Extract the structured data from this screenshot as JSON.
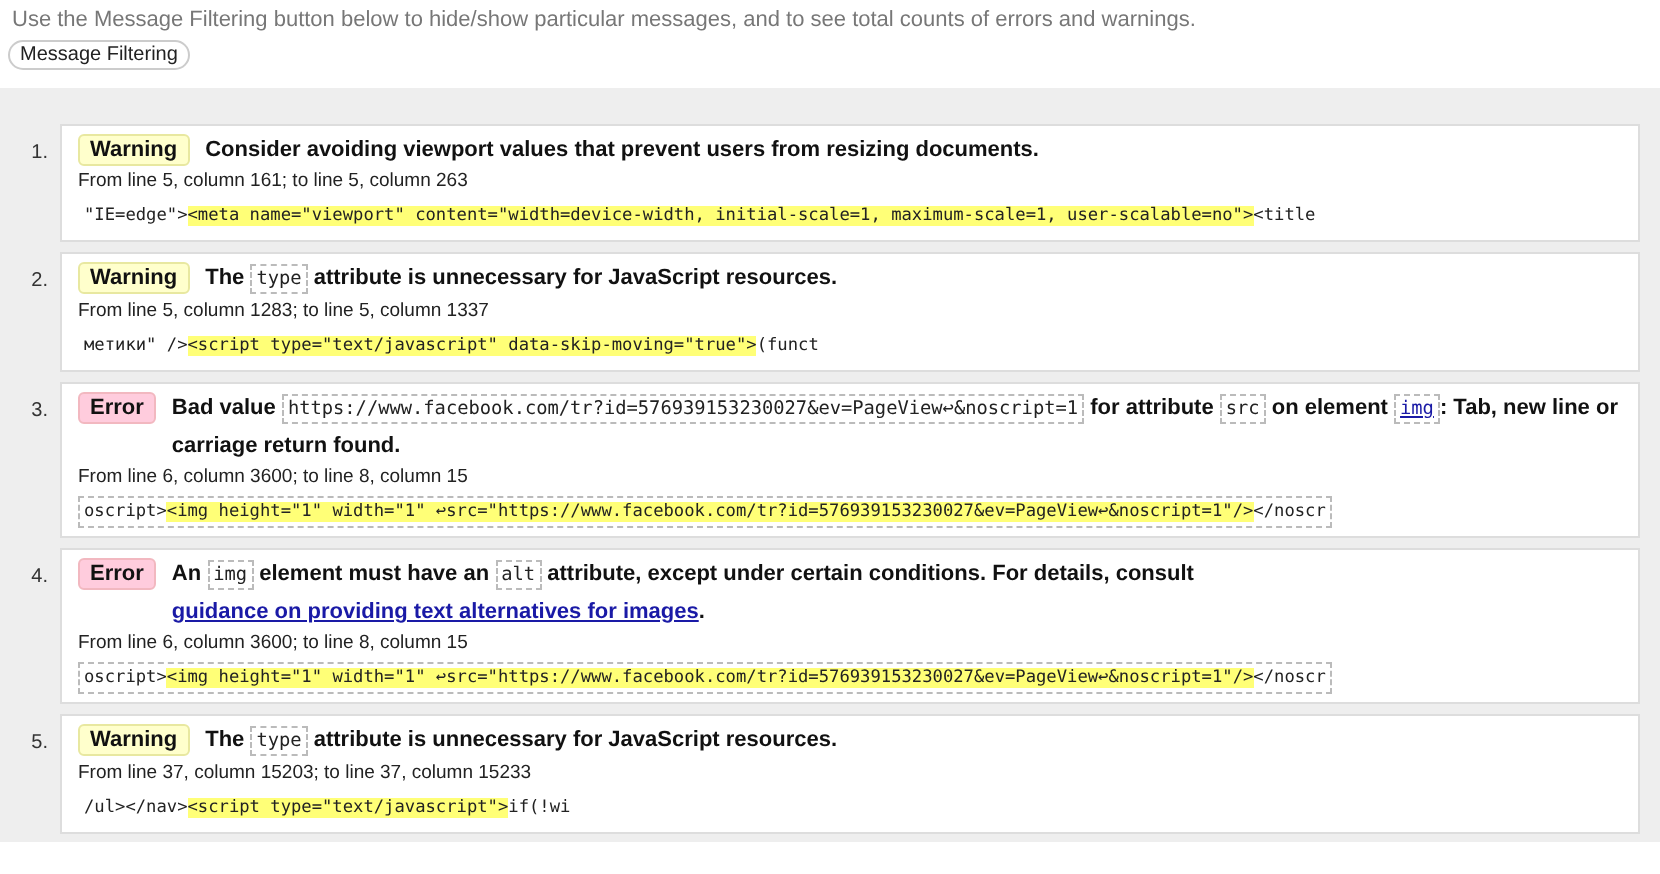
{
  "intro": "Use the Message Filtering button below to hide/show particular messages, and to see total counts of errors and warnings.",
  "filter_button": "Message Filtering",
  "messages": [
    {
      "number": "1.",
      "kind": "warning",
      "severity": "Warning",
      "parts": [
        {
          "kind": "text",
          "text": "Consider avoiding viewport values that prevent users from resizing documents."
        }
      ],
      "location": "From line 5, column 161; to line 5, column 263",
      "extract": {
        "before": "\"IE=edge\">",
        "highlight": "<meta name=\"viewport\" content=\"width=device-width, initial-scale=1, maximum-scale=1, user-scalable=no\">",
        "after": "<title"
      }
    },
    {
      "number": "2.",
      "kind": "warning",
      "severity": "Warning",
      "parts": [
        {
          "kind": "text",
          "text": "The "
        },
        {
          "kind": "code",
          "text": "type"
        },
        {
          "kind": "text",
          "text": " attribute is unnecessary for JavaScript resources."
        }
      ],
      "location": "From line 5, column 1283; to line 5, column 1337",
      "extract": {
        "before": "метики\" />",
        "highlight": "<script type=\"text/javascript\" data-skip-moving=\"true\">",
        "after": "(funct"
      }
    },
    {
      "number": "3.",
      "kind": "error",
      "severity": "Error",
      "parts": [
        {
          "kind": "text",
          "text": "Bad value "
        },
        {
          "kind": "code",
          "text": "https://www.facebook.com/tr?id=576939153230027&ev=PageView↩&noscript=1"
        },
        {
          "kind": "text",
          "text": " for attribute "
        },
        {
          "kind": "code",
          "text": "src"
        },
        {
          "kind": "text",
          "text": " on element "
        },
        {
          "kind": "code-link",
          "text": "img"
        },
        {
          "kind": "text",
          "text": ": Tab, new line or carriage return found."
        }
      ],
      "location": "From line 6, column 3600; to line 8, column 15",
      "extract": {
        "before": "oscript>",
        "highlight": "<img height=\"1\" width=\"1\" ↩src=\"https://www.facebook.com/tr?id=576939153230027&ev=PageView↩&noscript=1\"/>",
        "after": "</noscr"
      }
    },
    {
      "number": "4.",
      "kind": "error",
      "severity": "Error",
      "parts": [
        {
          "kind": "text",
          "text": "An "
        },
        {
          "kind": "code",
          "text": "img"
        },
        {
          "kind": "text",
          "text": " element must have an "
        },
        {
          "kind": "code",
          "text": "alt"
        },
        {
          "kind": "text",
          "text": " attribute, except under certain conditions. For details, consult "
        },
        {
          "kind": "link",
          "text": "guidance on providing text alternatives for images"
        },
        {
          "kind": "text",
          "text": "."
        }
      ],
      "location": "From line 6, column 3600; to line 8, column 15",
      "extract": {
        "before": "oscript>",
        "highlight": "<img height=\"1\" width=\"1\" ↩src=\"https://www.facebook.com/tr?id=576939153230027&ev=PageView↩&noscript=1\"/>",
        "after": "</noscr"
      }
    },
    {
      "number": "5.",
      "kind": "warning",
      "severity": "Warning",
      "parts": [
        {
          "kind": "text",
          "text": "The "
        },
        {
          "kind": "code",
          "text": "type"
        },
        {
          "kind": "text",
          "text": " attribute is unnecessary for JavaScript resources."
        }
      ],
      "location": "From line 37, column 15203; to line 37, column 15233",
      "extract": {
        "before": "/ul></nav>",
        "highlight": "<script type=\"text/javascript\">",
        "after": "if(!wi"
      }
    }
  ]
}
